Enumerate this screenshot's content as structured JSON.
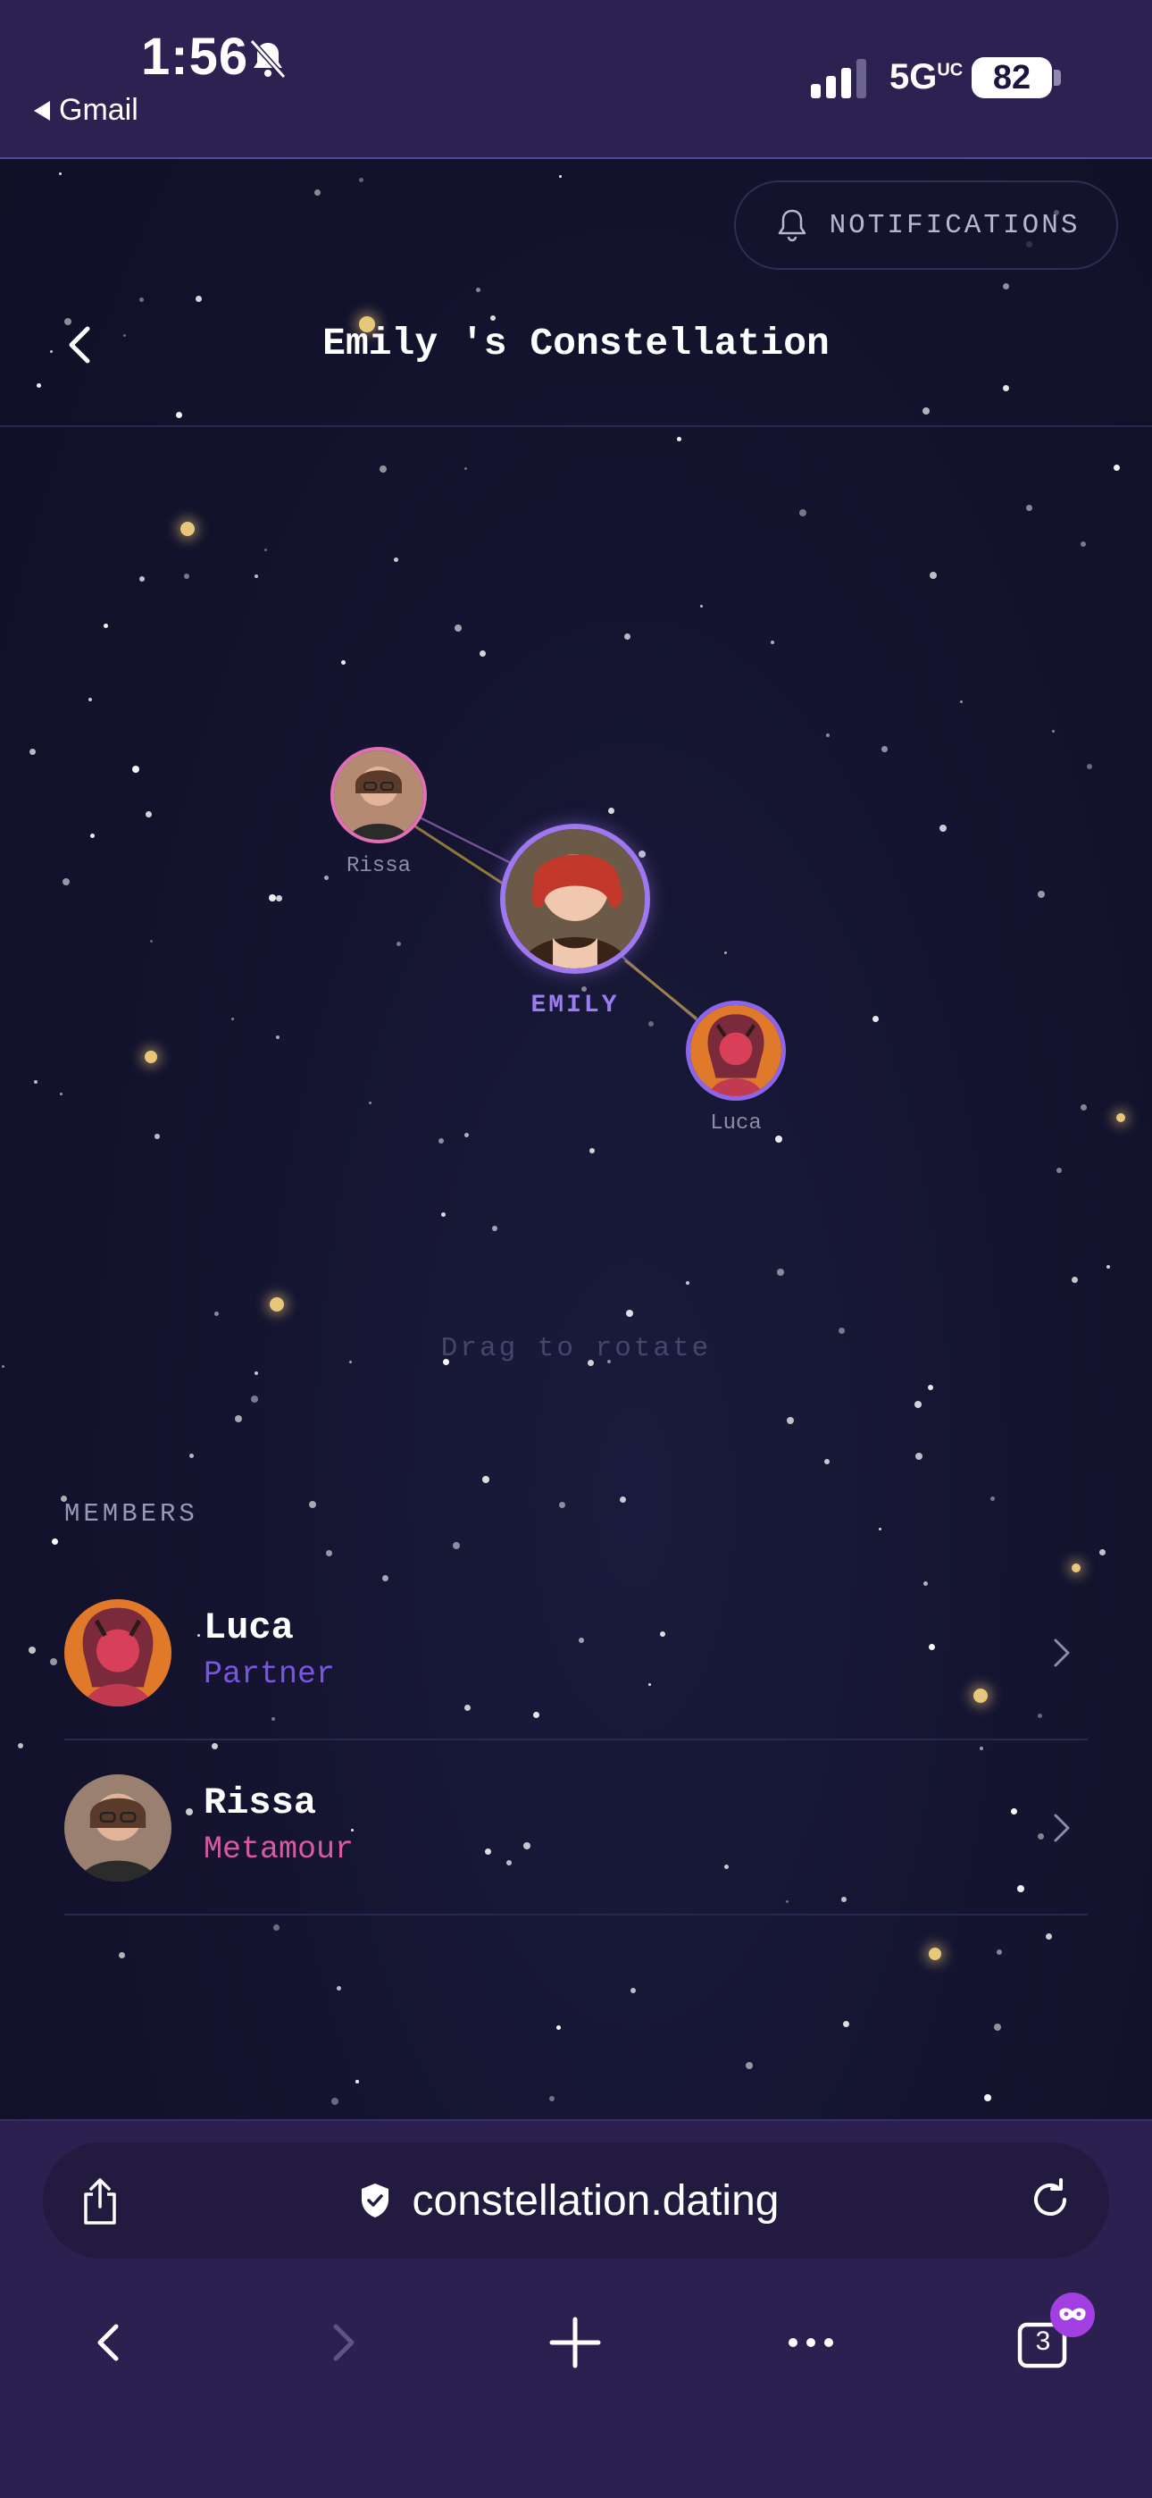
{
  "status_bar": {
    "time": "1:56",
    "back_app": "Gmail",
    "network": "5G",
    "network_suffix": "UC",
    "battery": "82",
    "icons": [
      "bell-slash-icon",
      "signal-icon",
      "battery-icon"
    ]
  },
  "header": {
    "notifications_label": "NOTIFICATIONS",
    "title": "Emily 's Constellation",
    "icons": [
      "bell-icon",
      "chevron-left-icon"
    ]
  },
  "constellation": {
    "nodes": [
      {
        "name": "Rissa",
        "role": "metamour",
        "ring_color": "#e06fb5"
      },
      {
        "name": "EMILY",
        "role": "center",
        "ring_color": "#9d78ee"
      },
      {
        "name": "Luca",
        "role": "partner",
        "ring_color": "#8b66ea"
      }
    ],
    "line_colors": [
      "#8a5fb0",
      "#a88a3a",
      "#6a6ab8"
    ],
    "hint": "Drag to rotate"
  },
  "members": {
    "heading": "MEMBERS",
    "items": [
      {
        "name": "Luca",
        "role": "Partner",
        "role_color": "#7a55df"
      },
      {
        "name": "Rissa",
        "role": "Metamour",
        "role_color": "#d85aa4"
      }
    ]
  },
  "browser": {
    "url": "constellation.dating",
    "tab_count": "3",
    "icons": [
      "share-icon",
      "shield-icon",
      "reload-icon",
      "back-icon",
      "forward-icon",
      "plus-icon",
      "more-icon",
      "tabs-icon",
      "private-mask-icon"
    ]
  },
  "theme": {
    "background": "#13122a",
    "chrome": "#2c2150",
    "accent_purple": "#9b7cf1",
    "accent_pink": "#d85aa4"
  }
}
